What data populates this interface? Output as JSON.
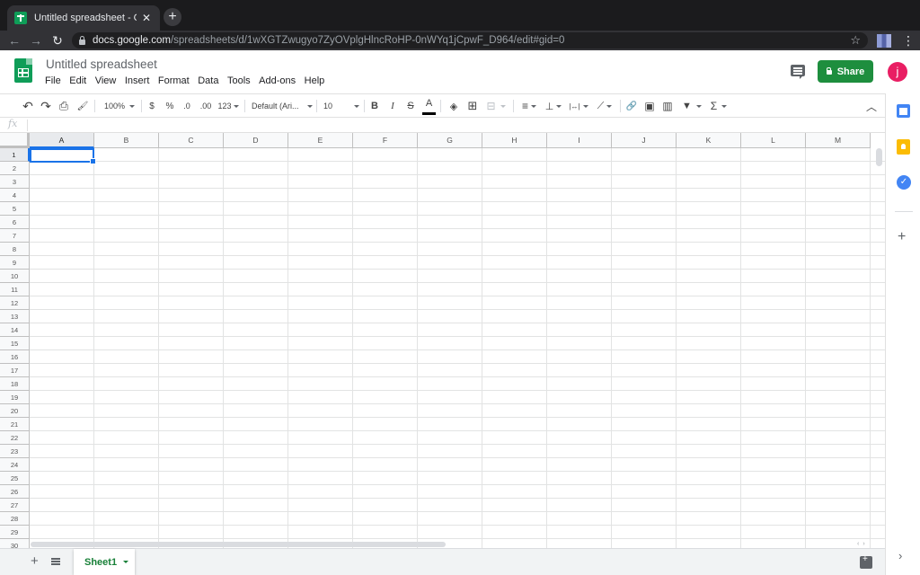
{
  "browser": {
    "tab_title": "Untitled spreadsheet - Google Sheets",
    "tab_close": "✕",
    "new_tab": "+",
    "url_domain": "docs.google.com",
    "url_path": "/spreadsheets/d/1wXGTZwugyo7ZyOVplgHlncRoHP-0nWYq1jCpwF_D964/edit#gid=0",
    "back": "←",
    "forward": "→",
    "reload": "↻",
    "star": "☆",
    "menu": "⋮"
  },
  "app": {
    "doc_title": "Untitled spreadsheet",
    "menu": [
      "File",
      "Edit",
      "View",
      "Insert",
      "Format",
      "Data",
      "Tools",
      "Add-ons",
      "Help"
    ],
    "share_label": "Share",
    "account_initial": "j"
  },
  "toolbar": {
    "undo": "↶",
    "redo": "↷",
    "print": "⎙",
    "paint_format": "🖌",
    "zoom": "100%",
    "currency": "$",
    "percent": "%",
    "decrease_decimal": ".0",
    "increase_decimal": ".00",
    "more_formats": "123",
    "font": "Default (Ari...",
    "font_size": "10",
    "bold": "B",
    "italic": "I",
    "strikethrough": "S",
    "text_color": "A",
    "fill_color": "◈",
    "borders": "⊞",
    "merge": "⊟",
    "h_align": "≡",
    "v_align": "⊥",
    "wrap": "|↔|",
    "rotate": "⟋",
    "link": "🔗",
    "comment": "▣",
    "chart": "▥",
    "filter": "▼",
    "functions": "Σ",
    "collapse": "︿"
  },
  "formula_bar": {
    "fx": "fx",
    "value": ""
  },
  "grid": {
    "columns": [
      "A",
      "B",
      "C",
      "D",
      "E",
      "F",
      "G",
      "H",
      "I",
      "J",
      "K",
      "L",
      "M"
    ],
    "rows": [
      "1",
      "2",
      "3",
      "4",
      "5",
      "6",
      "7",
      "8",
      "9",
      "10",
      "11",
      "12",
      "13",
      "14",
      "15",
      "16",
      "17",
      "18",
      "19",
      "20",
      "21",
      "22",
      "23",
      "24",
      "25",
      "26",
      "27",
      "28",
      "29",
      "30"
    ],
    "active_cell": "A1"
  },
  "sheets": {
    "tabs": [
      "Sheet1"
    ],
    "add": "+"
  },
  "side_panel": {
    "add": "+",
    "expand": "›",
    "tasks": "✓"
  }
}
